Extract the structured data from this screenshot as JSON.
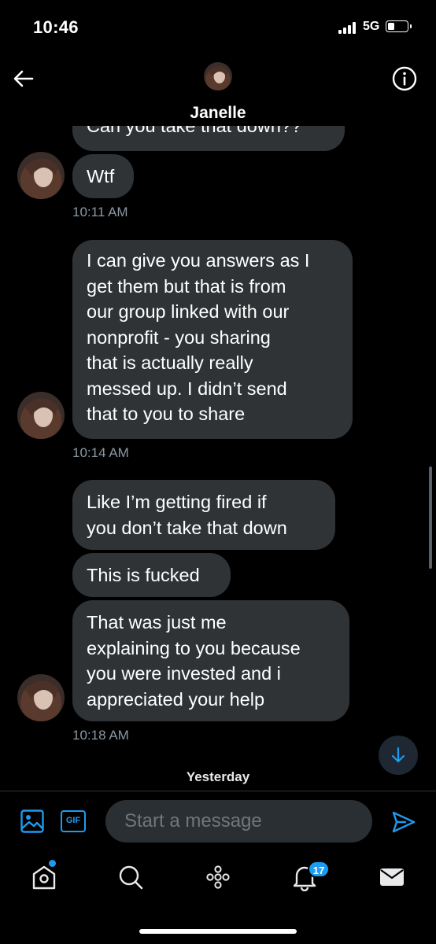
{
  "status_bar": {
    "time": "10:46",
    "network": "5G"
  },
  "header": {
    "contact_name": "Janelle"
  },
  "conversation": {
    "partial_message": "Can you take that down??",
    "groups": [
      {
        "messages": [
          {
            "lines": [
              "Wtf"
            ]
          }
        ],
        "timestamp": "10:11 AM"
      },
      {
        "messages": [
          {
            "lines": [
              "I can give you answers as I",
              "get them but that is from",
              "our group linked with our",
              "nonprofit - you sharing",
              "that is actually really",
              "messed up. I didn’t send",
              "that to you to share"
            ]
          }
        ],
        "timestamp": "10:14 AM"
      },
      {
        "messages": [
          {
            "lines": [
              "Like I’m getting fired if",
              "you don’t take that down"
            ]
          },
          {
            "lines": [
              "This is fucked"
            ]
          },
          {
            "lines": [
              "That was just me",
              "explaining to you because",
              "you were invested and i",
              "appreciated your help"
            ]
          }
        ],
        "timestamp": "10:18 AM"
      }
    ],
    "date_separator": "Yesterday"
  },
  "composer": {
    "placeholder": "Start a message",
    "gif_label": "GIF"
  },
  "nav": {
    "notifications_badge": "17"
  },
  "colors": {
    "accent": "#1d9bf0",
    "bubble": "#2f3336",
    "background": "#000000",
    "muted": "#8b98a5"
  },
  "icons": [
    "back-arrow-icon",
    "info-icon",
    "image-icon",
    "gif-icon",
    "send-icon",
    "home-icon",
    "search-icon",
    "spaces-icon",
    "notifications-icon",
    "messages-icon",
    "arrow-down-icon"
  ]
}
